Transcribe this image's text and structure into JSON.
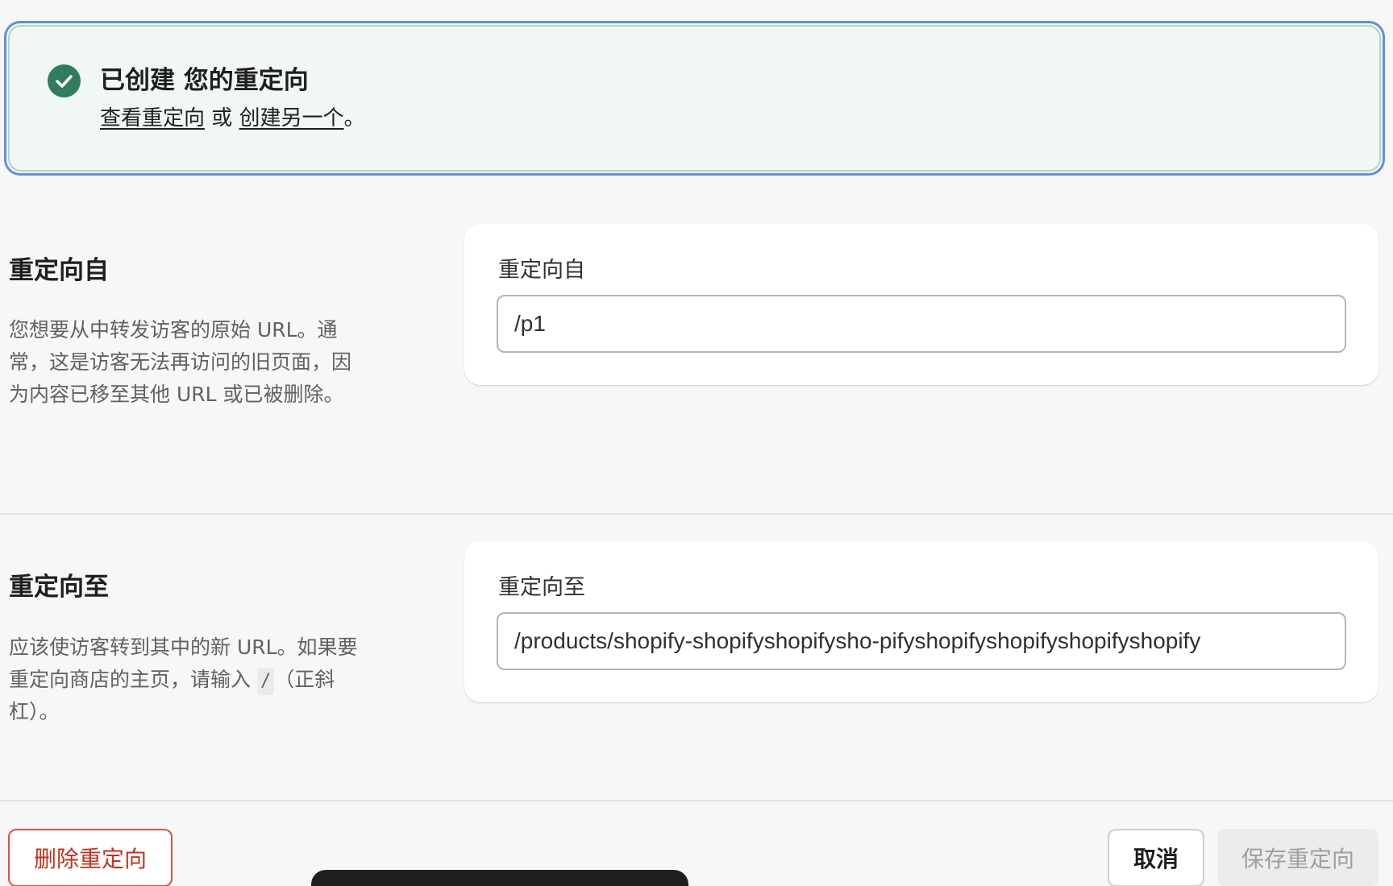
{
  "banner": {
    "title": "已创建 您的重定向",
    "link_view": "查看重定向",
    "or_text": " 或 ",
    "link_create": "创建另一个",
    "period": "。",
    "accent_color": "#2f7d5b"
  },
  "redirect_from": {
    "heading": "重定向自",
    "description": "您想要从中转发访客的原始 URL。通常，这是访客无法再访问的旧页面，因为内容已移至其他 URL 或已被删除。",
    "field_label": "重定向自",
    "value": "/p1"
  },
  "redirect_to": {
    "heading": "重定向至",
    "description_before": "应该使访客转到其中的新 URL。如果要重定向商店的主页，请输入 ",
    "code": "/",
    "description_after": "（正斜杠）。",
    "field_label": "重定向至",
    "value": "/products/shopify-shopifyshopifysho-pifyshopifyshopifyshopifyshopify"
  },
  "footer": {
    "delete_label": "删除重定向",
    "cancel_label": "取消",
    "save_label": "保存重定向",
    "delete_color": "#c4321c"
  }
}
